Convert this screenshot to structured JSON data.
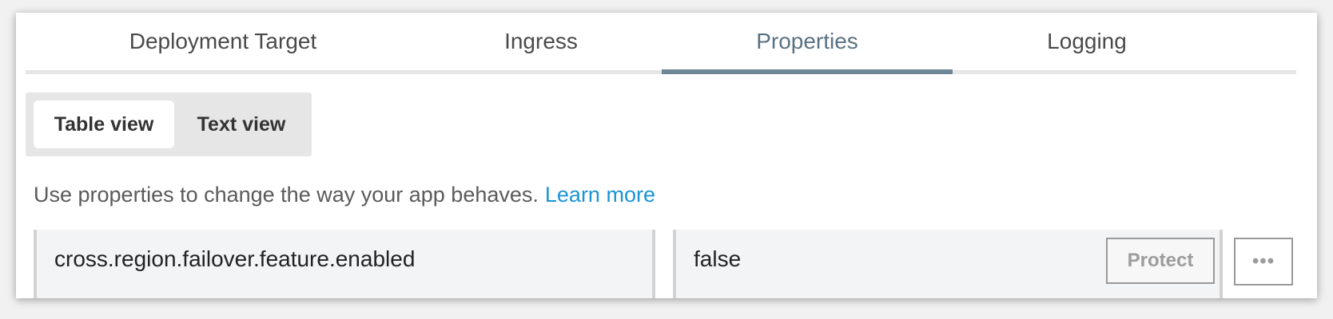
{
  "tabs": [
    {
      "label": "Deployment Target",
      "active": false
    },
    {
      "label": "Ingress",
      "active": false
    },
    {
      "label": "Properties",
      "active": true
    },
    {
      "label": "Logging",
      "active": false
    }
  ],
  "view_toggle": {
    "table_label": "Table view",
    "text_label": "Text view",
    "selected": "Table view"
  },
  "description": {
    "text": "Use properties to change the way your app behaves.",
    "link_label": "Learn more"
  },
  "property_row": {
    "key": "cross.region.failover.feature.enabled",
    "value": "false",
    "protect_label": "Protect",
    "more_label": "•••"
  },
  "colors": {
    "active_tab": "#5b7282",
    "active_tab_underline": "#6e8797",
    "link": "#1a94d4"
  },
  "icons": {
    "more": "more-horizontal-icon"
  }
}
